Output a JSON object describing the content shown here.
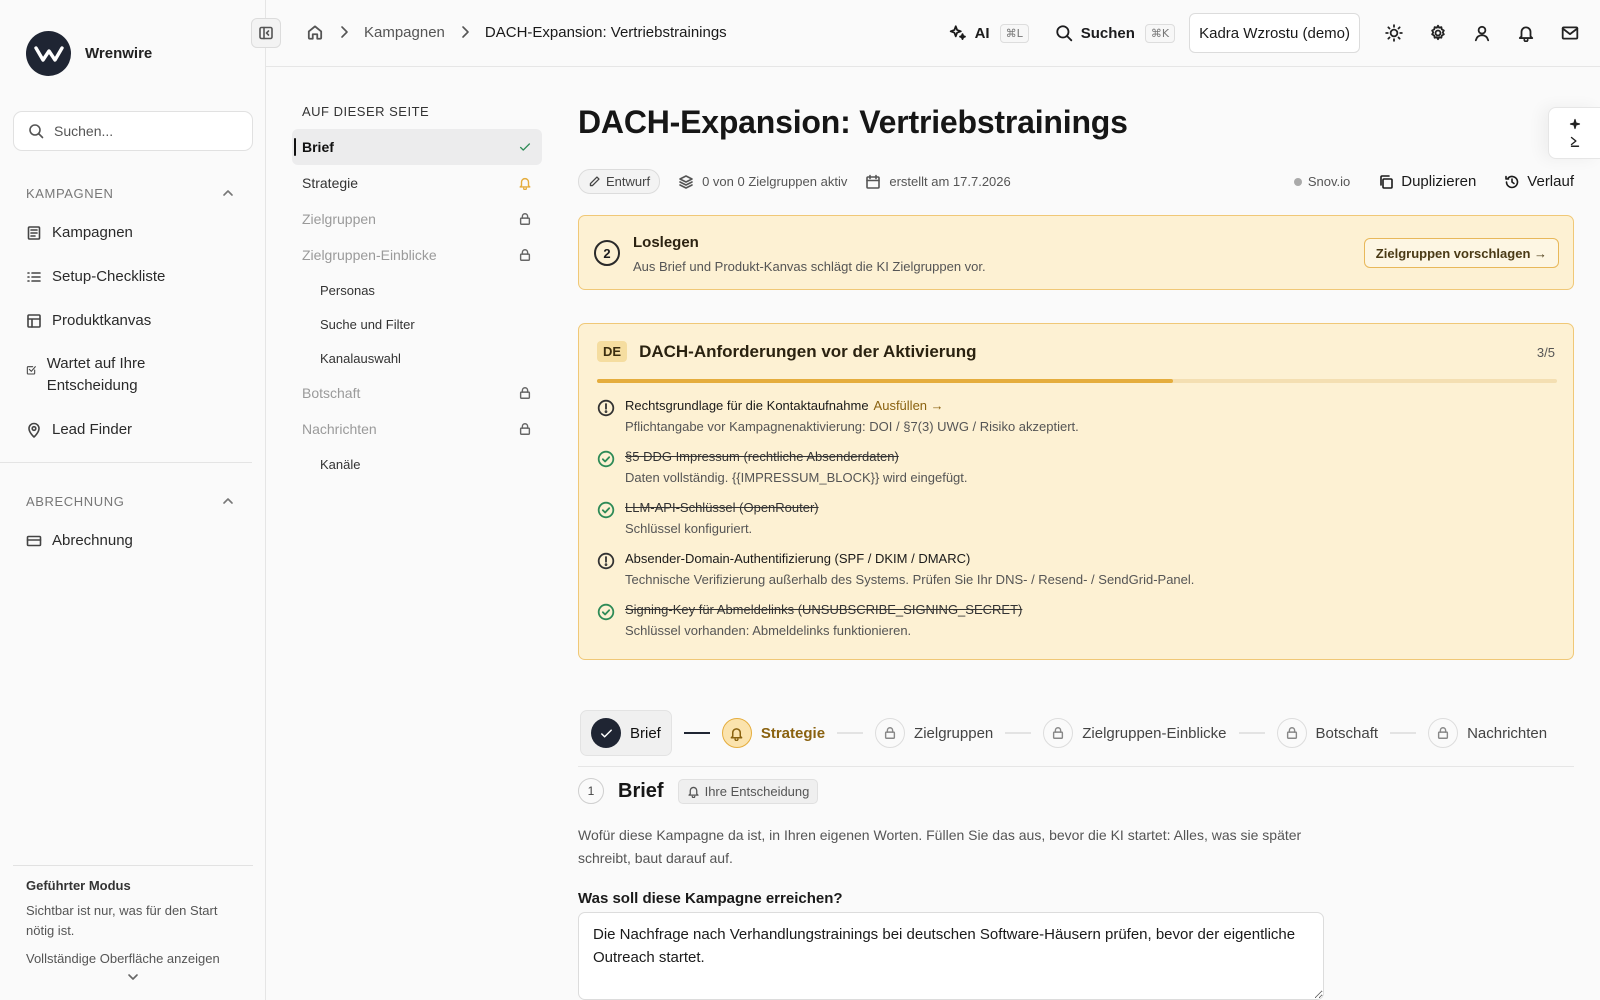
{
  "brand": {
    "name": "Wrenwire"
  },
  "sidebar": {
    "search_placeholder": "Suchen...",
    "section_campaigns": "KAMPAGNEN",
    "campaign_items": [
      {
        "label": "Kampagnen",
        "icon": "campaign-icon"
      },
      {
        "label": "Setup-Checkliste",
        "icon": "checklist-icon"
      },
      {
        "label": "Produktkanvas",
        "icon": "canvas-icon"
      },
      {
        "label": "Wartet auf Ihre Entscheidung",
        "icon": "decision-icon"
      },
      {
        "label": "Lead Finder",
        "icon": "location-pin-icon"
      }
    ],
    "section_billing": "ABRECHNUNG",
    "billing_items": [
      {
        "label": "Abrechnung",
        "icon": "card-icon"
      }
    ],
    "guided": {
      "title": "Geführter Modus",
      "desc": "Sichtbar ist nur, was für den Start nötig ist.",
      "link": "Vollständige Oberfläche anzeigen"
    }
  },
  "topbar": {
    "breadcrumb": [
      "Kampagnen",
      "DACH-Expansion: Vertriebstrainings"
    ],
    "ai_label": "AI",
    "ai_shortcut": "⌘L",
    "search_label": "Suchen",
    "search_shortcut": "⌘K",
    "org": "Kadra Wzrostu (demo)"
  },
  "toc": {
    "heading": "AUF DIESER SEITE",
    "items": [
      {
        "label": "Brief",
        "state": "active"
      },
      {
        "label": "Strategie",
        "state": "pending"
      },
      {
        "label": "Zielgruppen",
        "state": "locked"
      },
      {
        "label": "Zielgruppen-Einblicke",
        "state": "locked"
      },
      {
        "label": "Personas",
        "state": "sub"
      },
      {
        "label": "Suche und Filter",
        "state": "sub"
      },
      {
        "label": "Kanalauswahl",
        "state": "sub"
      },
      {
        "label": "Botschaft",
        "state": "locked"
      },
      {
        "label": "Nachrichten",
        "state": "locked"
      },
      {
        "label": "Kanäle",
        "state": "sub"
      }
    ]
  },
  "page": {
    "title": "DACH-Expansion: Vertriebstrainings",
    "status": "Entwurf",
    "audiences_active": "0 von 0 Zielgruppen aktiv",
    "created": "erstellt am 17.7.2026",
    "provider": "Snov.io",
    "duplicate": "Duplizieren",
    "history": "Verlauf"
  },
  "start_card": {
    "step": "2",
    "title": "Loslegen",
    "desc": "Aus Brief und Produkt-Kanvas schlägt die KI Zielgruppen vor.",
    "button": "Zielgruppen vorschlagen →"
  },
  "requirements": {
    "badge": "DE",
    "title": "DACH-Anforderungen vor der Aktivierung",
    "count": "3/5",
    "progress": 0.6,
    "items": [
      {
        "title": "Rechtsgrundlage für die Kontaktaufnahme",
        "link": "Ausfüllen →",
        "desc": "Pflichtangabe vor Kampagnenaktivierung: DOI / §7(3) UWG / Risiko akzeptiert.",
        "done": false
      },
      {
        "title": "§5 DDG Impressum (rechtliche Absenderdaten)",
        "link": "",
        "desc": "Daten vollständig. {{IMPRESSUM_BLOCK}} wird eingefügt.",
        "done": true
      },
      {
        "title": "LLM-API-Schlüssel (OpenRouter)",
        "link": "",
        "desc": "Schlüssel konfiguriert.",
        "done": true
      },
      {
        "title": "Absender-Domain-Authentifizierung (SPF / DKIM / DMARC)",
        "link": "",
        "desc": "Technische Verifizierung außerhalb des Systems. Prüfen Sie Ihr DNS- / Resend- / SendGrid-Panel.",
        "done": false
      },
      {
        "title": "Signing-Key für Abmeldelinks (UNSUBSCRIBE_SIGNING_SECRET)",
        "link": "",
        "desc": "Schlüssel vorhanden: Abmeldelinks funktionieren.",
        "done": true
      }
    ]
  },
  "stepper": [
    {
      "label": "Brief",
      "state": "done"
    },
    {
      "label": "Strategie",
      "state": "active"
    },
    {
      "label": "Zielgruppen",
      "state": "locked"
    },
    {
      "label": "Zielgruppen-Einblicke",
      "state": "locked"
    },
    {
      "label": "Botschaft",
      "state": "locked"
    },
    {
      "label": "Nachrichten",
      "state": "locked"
    }
  ],
  "brief": {
    "num": "1",
    "title": "Brief",
    "badge": "Ihre Entscheidung",
    "desc": "Wofür diese Kampagne da ist, in Ihren eigenen Worten. Füllen Sie das aus, bevor die KI startet: Alles, was sie später schreibt, baut darauf auf.",
    "question": "Was soll diese Kampagne erreichen?",
    "answer": "Die Nachfrage nach Verhandlungstrainings bei deutschen Software-Häusern prüfen, bevor der eigentliche Outreach startet."
  },
  "colors": {
    "accent": "#e5ad3d",
    "warning_bg": "#fdf1d3",
    "success": "#2e8b57",
    "dark": "#1f2533"
  }
}
